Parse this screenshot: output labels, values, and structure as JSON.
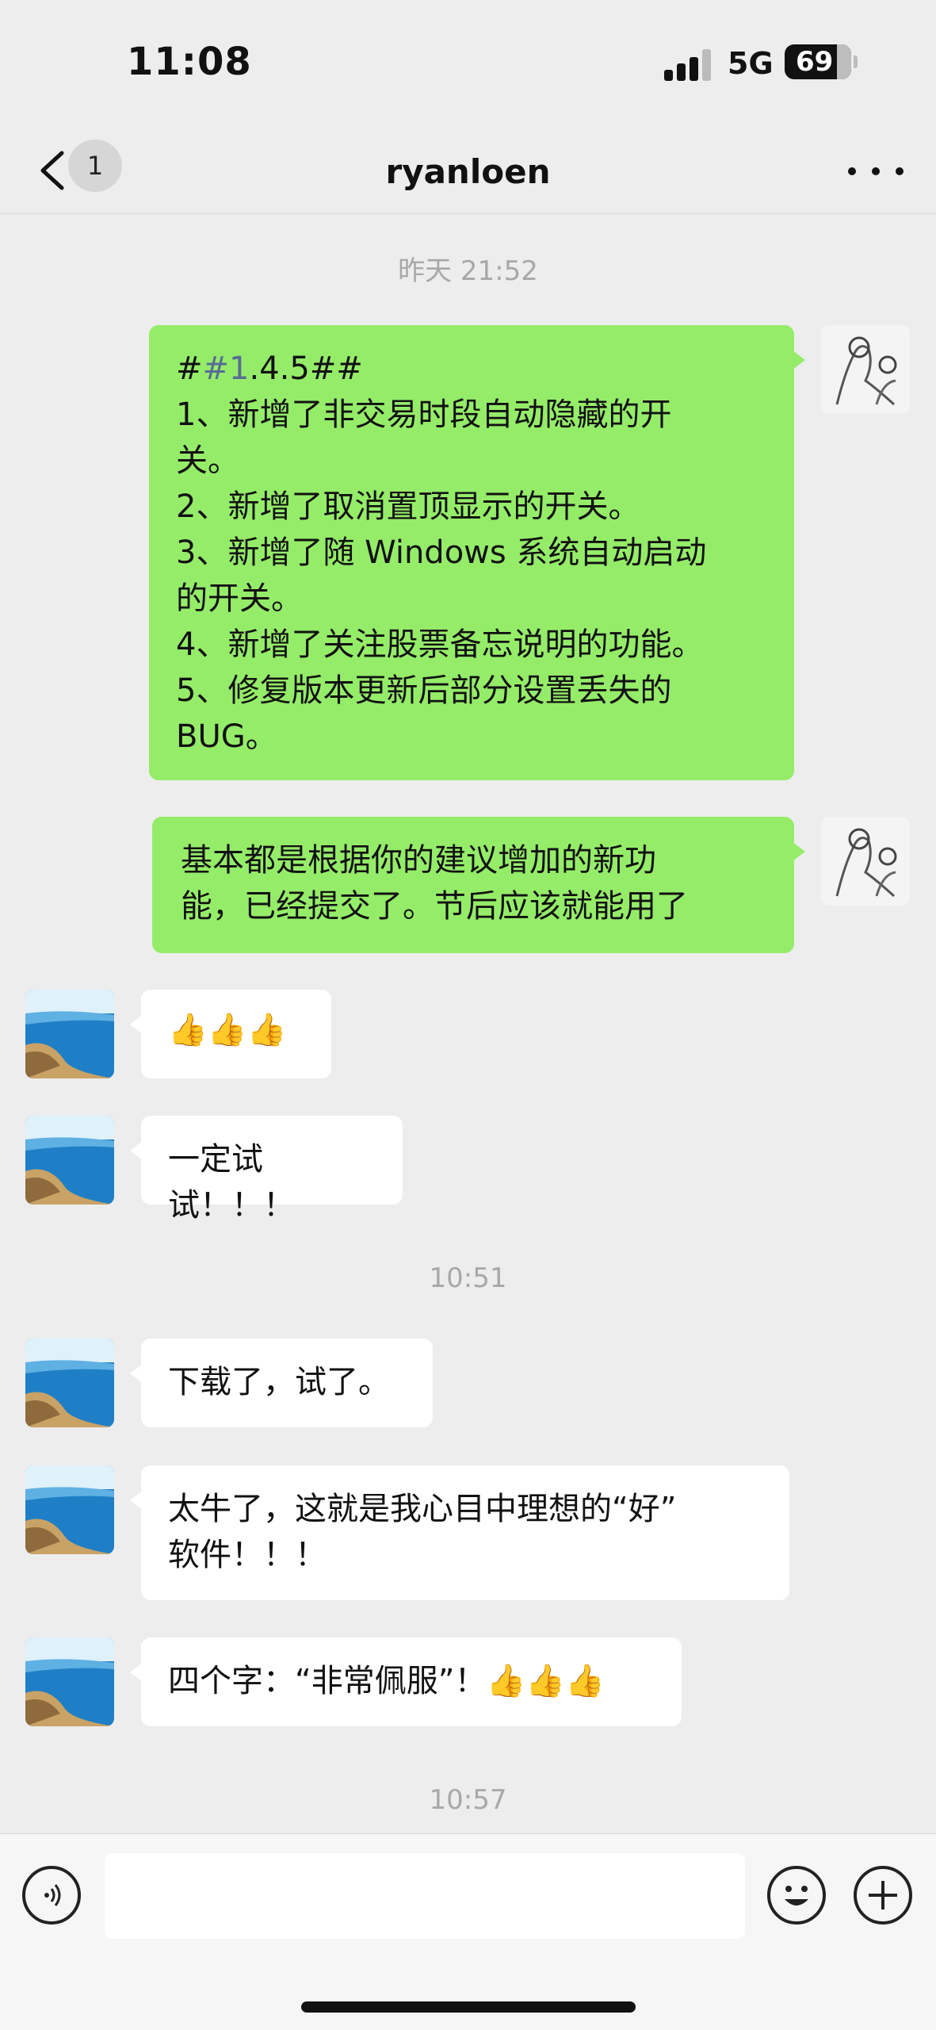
{
  "status_bar": {
    "time": "11:08",
    "network": "5G",
    "battery": "69"
  },
  "nav": {
    "title": "ryanloen",
    "unread_count": "1"
  },
  "timestamps": [
    "昨天 21:52",
    "10:51",
    "10:57"
  ],
  "messages": {
    "m1": {
      "lines": [
        "#",
        "#1",
        ".4.5##",
        "1、新增了非交易时段自动隐藏的开",
        "关。",
        "2、新增了取消置顶显示的开关。",
        "3、新增了随 Windows 系统自动启动",
        "的开关。",
        "4、新增了关注股票备忘说明的功能。",
        "5、修复版本更新后部分设置丢失的",
        "BUG。"
      ]
    },
    "m2": {
      "lines": [
        "基本都是根据你的建议增加的新功",
        "能，已经提交了。节后应该就能用了"
      ]
    },
    "m3": {
      "text": "👍👍👍"
    },
    "m4": {
      "text": "一定试试！！！"
    },
    "m5": {
      "text": "下载了，试了。"
    },
    "m6": {
      "lines": [
        "太牛了，这就是我心目中理想的“好”",
        "软件！！！"
      ]
    },
    "m7": {
      "text": "四个字：“非常佩服”！👍👍👍"
    }
  },
  "input": {
    "value": ""
  },
  "icons": {
    "back": "chevron-left-icon",
    "more": "more-dots-icon",
    "voice": "voice-icon",
    "emoji": "emoji-icon",
    "plus": "plus-icon"
  },
  "colors": {
    "outgoing_bubble": "#95ec69",
    "incoming_bubble": "#ffffff",
    "background": "#ededed",
    "link": "#576b95"
  }
}
